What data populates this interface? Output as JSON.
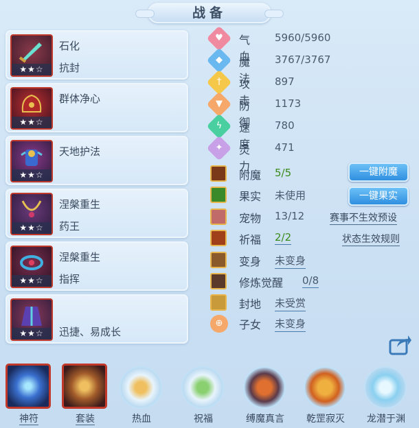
{
  "title": "战备",
  "skills": [
    {
      "name": "石化",
      "sub": "抗封",
      "stars": "★★☆"
    },
    {
      "name": "群体净心",
      "sub": "",
      "stars": "★★☆"
    },
    {
      "name": "天地护法",
      "sub": "",
      "stars": "★★☆"
    },
    {
      "name": "涅槃重生",
      "sub": "药王",
      "stars": "★★☆"
    },
    {
      "name": "涅槃重生",
      "sub": "指挥",
      "stars": "★★☆"
    },
    {
      "name": "",
      "sub": "迅捷、易成长",
      "stars": "★★☆"
    }
  ],
  "stats": [
    {
      "label": "气血",
      "value": "5960/5960",
      "icon": "heart-icon",
      "color": "#f08aa0"
    },
    {
      "label": "魔法",
      "value": "3767/3767",
      "icon": "magic-icon",
      "color": "#6ab8f0"
    },
    {
      "label": "攻击",
      "value": "897",
      "icon": "sword-icon",
      "color": "#f5c84a"
    },
    {
      "label": "防御",
      "value": "1173",
      "icon": "shield-icon",
      "color": "#f5a86a"
    },
    {
      "label": "速度",
      "value": "780",
      "icon": "lightning-icon",
      "color": "#4ad0a0"
    },
    {
      "label": "灵力",
      "value": "471",
      "icon": "spirit-icon",
      "color": "#c8a0e8"
    }
  ],
  "rows": [
    {
      "label": "附魔",
      "value": "5/5"
    },
    {
      "label": "果实",
      "value": "未使用"
    },
    {
      "label": "宠物",
      "value": "13/12"
    },
    {
      "label": "祈福",
      "value": "2/2"
    },
    {
      "label": "变身",
      "value": "未变身"
    },
    {
      "label": "修炼觉醒",
      "value": "0/8"
    },
    {
      "label": "封地",
      "value": "未受赏"
    },
    {
      "label": "子女",
      "value": "未变身"
    }
  ],
  "buttons": {
    "enchant": "一键附魔",
    "fruit": "一键果实"
  },
  "links": {
    "preset": "赛事不生效预设",
    "rules": "状态生效规则"
  },
  "bottom": [
    {
      "label": "神符"
    },
    {
      "label": "套装"
    },
    {
      "label": "热血"
    },
    {
      "label": "祝福"
    },
    {
      "label": "缚魔真言"
    },
    {
      "label": "乾罡寂灭"
    },
    {
      "label": "龙潜于渊"
    }
  ]
}
